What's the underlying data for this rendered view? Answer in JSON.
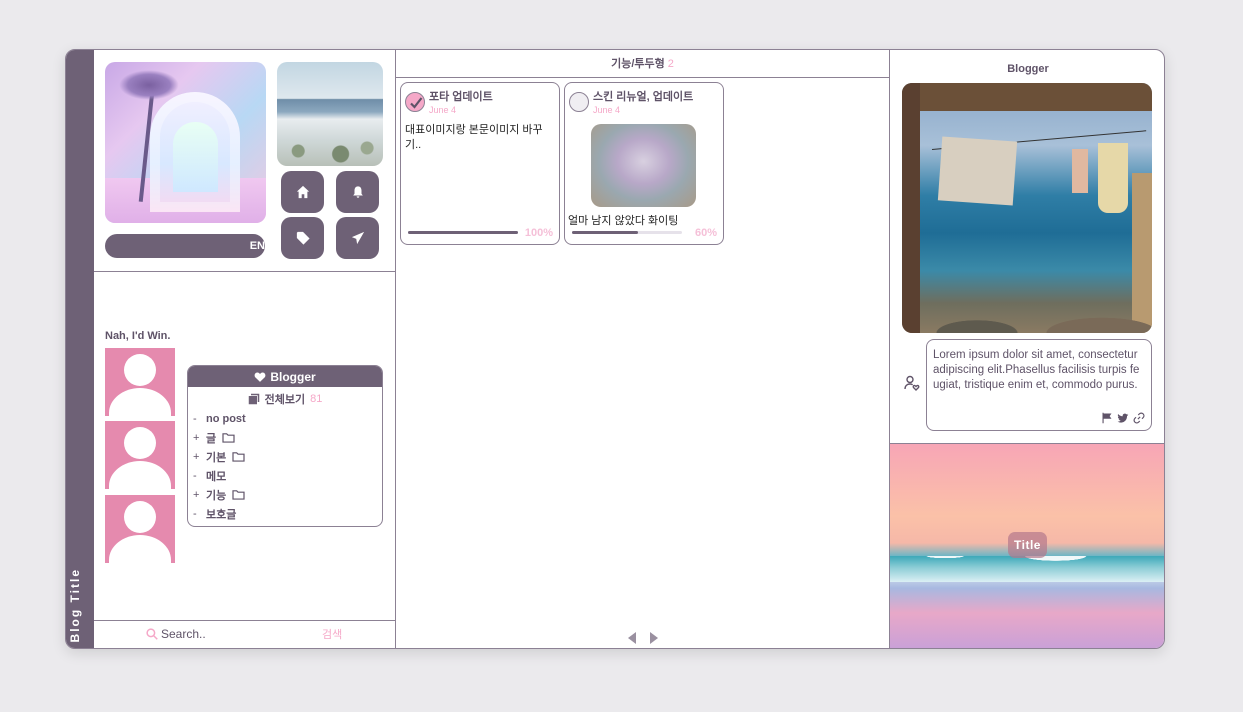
{
  "spine": {
    "blog_title": "Blog Title"
  },
  "left": {
    "lang_label": "EN",
    "nav": [
      "home-icon",
      "bell-icon",
      "tag-icon",
      "send-icon"
    ],
    "tagline": "Nah, I'd Win.",
    "categories": {
      "header": "Blogger",
      "all_label": "전체보기",
      "all_count": "81",
      "items": [
        {
          "sym": "-",
          "label": "no post",
          "folder": false
        },
        {
          "sym": "+",
          "label": "글",
          "folder": true
        },
        {
          "sym": "+",
          "label": "기본",
          "folder": true
        },
        {
          "sym": "-",
          "label": "메모",
          "folder": false
        },
        {
          "sym": "+",
          "label": "기능",
          "folder": true
        },
        {
          "sym": "-",
          "label": "보호글",
          "folder": false
        }
      ]
    },
    "search": {
      "placeholder": "Search..",
      "button": "검색"
    }
  },
  "middle": {
    "header": "기능/투두형",
    "header_count": "2",
    "cards": [
      {
        "title": "포타 업데이트",
        "date": "June 4",
        "checked": true,
        "body": "대표이미지랑 본문이미지 바꾸기..",
        "progress": 1.0,
        "progress_label": "100%"
      },
      {
        "title": "스킨 리뉴얼, 업데이트",
        "date": "June 4",
        "checked": false,
        "body": "얼마 남지 않았다 화이팅",
        "progress": 0.6,
        "progress_label": "60%"
      }
    ]
  },
  "right": {
    "header": "Blogger",
    "about": "Lorem ipsum dolor sit amet, consectetur adipiscing elit.Phasellus facilisis turpis feugiat, tristique enim et, commodo purus.",
    "socials": [
      "flag-icon",
      "twitter-icon",
      "link-icon"
    ],
    "banner_title": "Title"
  },
  "colors": {
    "accent": "#6e6176",
    "pink": "#f5a8c8",
    "avatar_bg": "#e58aae"
  }
}
